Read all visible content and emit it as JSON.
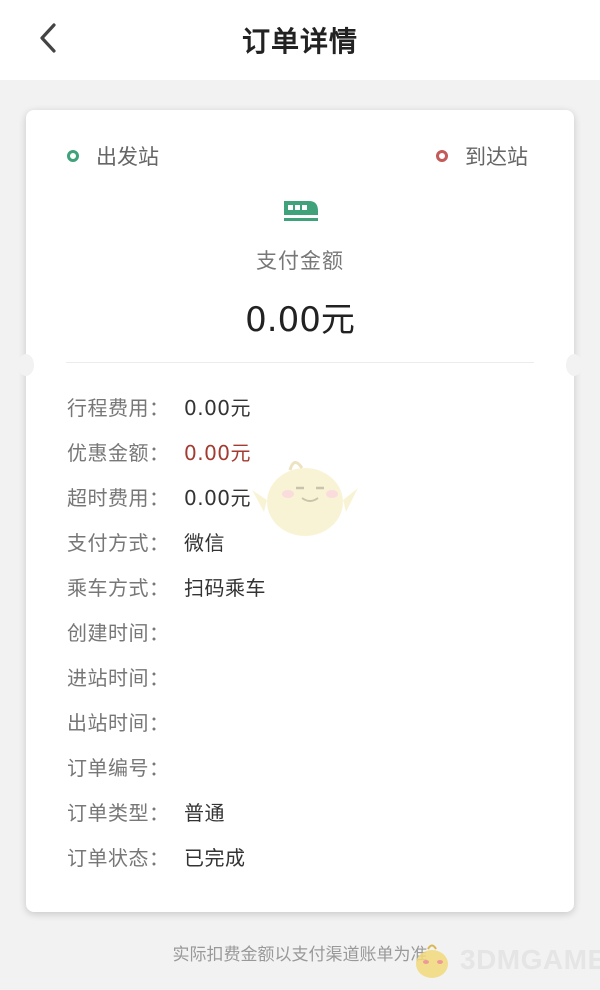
{
  "header": {
    "title": "订单详情",
    "back_icon": "chevron-left-icon"
  },
  "route": {
    "departure_label": "出发站",
    "arrival_label": "到达站",
    "departure_color": "#3fa27a",
    "arrival_color": "#c45a5a"
  },
  "payment": {
    "icon": "train-icon",
    "label": "支付金额",
    "amount": "0.00元"
  },
  "details": [
    {
      "label": "行程费用：",
      "value": "0.00元"
    },
    {
      "label": "优惠金额：",
      "value": "0.00元"
    },
    {
      "label": "超时费用：",
      "value": "0.00元"
    },
    {
      "label": "支付方式：",
      "value": "微信"
    },
    {
      "label": "乘车方式：",
      "value": "扫码乘车"
    },
    {
      "label": "创建时间：",
      "value": ""
    },
    {
      "label": "进站时间：",
      "value": ""
    },
    {
      "label": "出站时间：",
      "value": ""
    },
    {
      "label": "订单编号：",
      "value": ""
    },
    {
      "label": "订单类型：",
      "value": "普通"
    },
    {
      "label": "订单状态：",
      "value": "已完成"
    }
  ],
  "footer": {
    "note": "实际扣费金额以支付渠道账单为准"
  },
  "watermark": {
    "text": "3DMGAME"
  },
  "colors": {
    "accent_green": "#3fa27a",
    "discount_red": "#a33b30",
    "background": "#f2f2f2"
  }
}
